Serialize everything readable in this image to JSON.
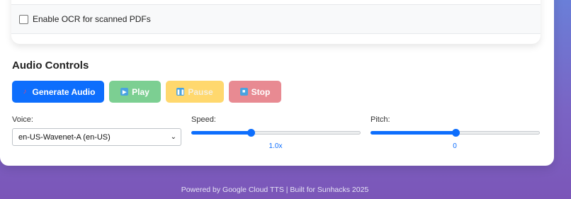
{
  "ocr": {
    "label": "Enable OCR for scanned PDFs",
    "checked": false
  },
  "audio_controls": {
    "title": "Audio Controls",
    "buttons": {
      "generate": {
        "label": "Generate Audio",
        "icon": "music-note-icon"
      },
      "play": {
        "label": "Play",
        "icon": "play-icon"
      },
      "pause": {
        "label": "Pause",
        "icon": "pause-icon"
      },
      "stop": {
        "label": "Stop",
        "icon": "stop-icon"
      }
    }
  },
  "voice": {
    "label": "Voice:",
    "selected": "en-US-Wavenet-A (en-US)"
  },
  "speed": {
    "label": "Speed:",
    "value_text": "1.0x",
    "fraction": 0.35
  },
  "pitch": {
    "label": "Pitch:",
    "value_text": "0",
    "fraction": 0.5
  },
  "footer": {
    "text": "Powered by Google Cloud TTS | Built for Sunhacks 2025"
  },
  "colors": {
    "primary": "#0d6efd",
    "success": "#7ccf92",
    "warning": "#ffd86e",
    "danger": "#e88a92"
  }
}
